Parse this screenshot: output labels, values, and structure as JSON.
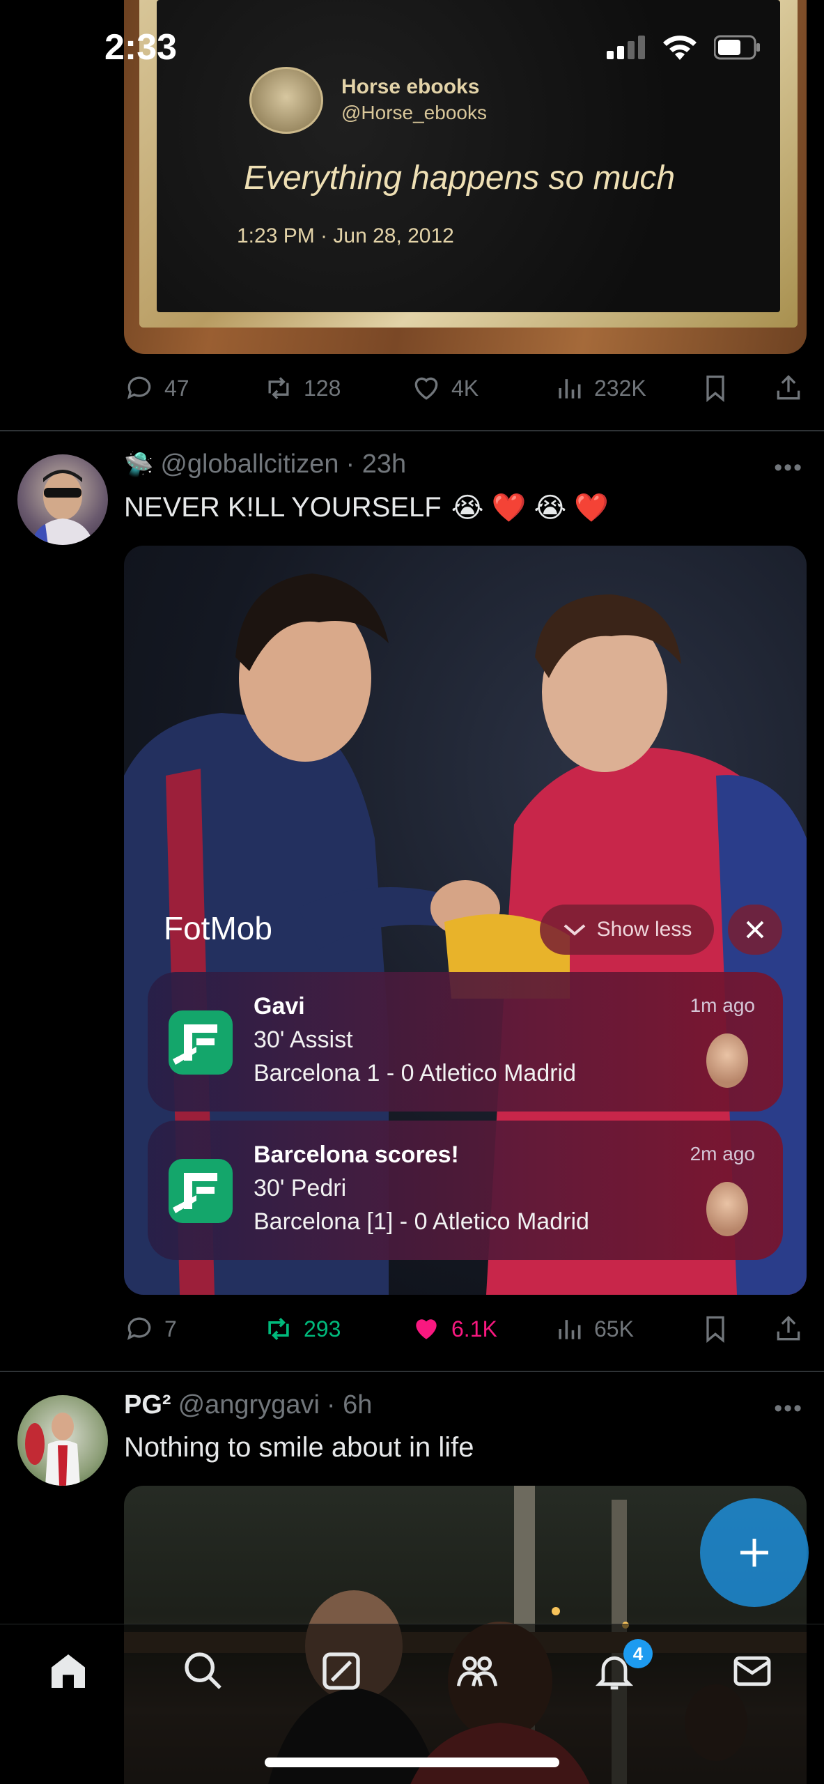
{
  "status_bar": {
    "time": "2:33"
  },
  "tweet1": {
    "plaque": {
      "name": "Horse ebooks",
      "handle": "@Horse_ebooks",
      "text": "Everything happens so much",
      "date": "1:23 PM · Jun 28, 2012"
    },
    "stats": {
      "replies": "47",
      "retweets": "128",
      "likes": "4K",
      "views": "232K"
    }
  },
  "tweet2": {
    "emoji": "🛸",
    "handle": "@globallcitizen",
    "time": "· 23h",
    "text": "NEVER K!LL YOURSELF",
    "emojis": "😭 ❤️ 😭 ❤️",
    "notification_app": "FotMob",
    "show_less": "Show less",
    "notifications": [
      {
        "title": "Gavi",
        "line2": "30' Assist",
        "line3": "Barcelona 1 - 0 Atletico Madrid",
        "time": "1m ago"
      },
      {
        "title": "Barcelona scores!",
        "line2": "30' Pedri",
        "line3": "Barcelona [1] - 0 Atletico Madrid",
        "time": "2m ago"
      }
    ],
    "stats": {
      "replies": "7",
      "retweets": "293",
      "likes": "6.1K",
      "views": "65K"
    }
  },
  "tweet3": {
    "name": "PG²",
    "handle": "@angrygavi",
    "time": "· 6h",
    "text": "Nothing to smile about in life"
  },
  "nav": {
    "notification_count": "4"
  },
  "colors": {
    "accent": "#1d9bf0",
    "retweet_green": "#00ba7c",
    "like_pink": "#f91880",
    "muted": "#71767b"
  }
}
